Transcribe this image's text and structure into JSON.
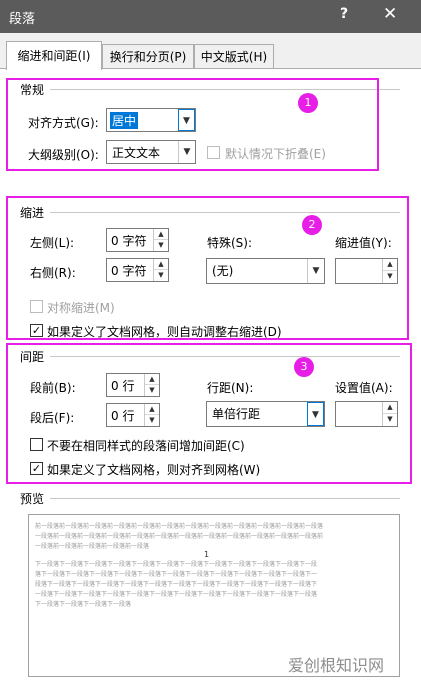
{
  "window": {
    "title": "段落",
    "help_glyph": "?",
    "close_glyph": "✕"
  },
  "tabs": [
    {
      "label": "缩进和间距(I)",
      "active": true
    },
    {
      "label": "换行和分页(P)",
      "active": false
    },
    {
      "label": "中文版式(H)",
      "active": false
    }
  ],
  "general": {
    "title": "常规",
    "alignment_label": "对齐方式(G):",
    "alignment_value": "居中",
    "outline_label": "大纲级别(O):",
    "outline_value": "正文文本",
    "collapse_label": "默认情况下折叠(E)",
    "collapse_checked": false
  },
  "indent": {
    "title": "缩进",
    "left_label": "左侧(L):",
    "left_value": "0 字符",
    "right_label": "右侧(R):",
    "right_value": "0 字符",
    "special_label": "特殊(S):",
    "special_value": "(无)",
    "by_label": "缩进值(Y):",
    "by_value": "",
    "mirror_label": "对称缩进(M)",
    "mirror_checked": false,
    "auto_adjust_label": "如果定义了文档网格，则自动调整右缩进(D)",
    "auto_adjust_checked": true
  },
  "spacing": {
    "title": "间距",
    "before_label": "段前(B):",
    "before_value": "0 行",
    "after_label": "段后(F):",
    "after_value": "0 行",
    "line_label": "行距(N):",
    "line_value": "单倍行距",
    "at_label": "设置值(A):",
    "at_value": "",
    "no_space_label": "不要在相同样式的段落间增加间距(C)",
    "no_space_checked": false,
    "snap_grid_label": "如果定义了文档网格，则对齐到网格(W)",
    "snap_grid_checked": true
  },
  "preview": {
    "title": "预览",
    "lines": [
      "前一段落前一段落前一段落前一段落前一段落前一段落前一段落前一段落前一段落前一段落前一段落前一段落",
      "一段落前一段落前一段落前一段落前一段落前一段落前一段落前一段落前一段落前一段落前一段落前一段落前",
      "一段落前一段落前一段落前一段落前一段落",
      "下一段落下一段落下一段落下一段落下一段落下一段落下一段落下一段落下一段落下一段落下一段落下一段",
      "落下一段落下一段落下一段落下一段落下一段落下一段落下一段落下一段落下一段落下一段落下一段落下一",
      "段落下一段落下一段落下一段落下一段落下一段落下一段落下一段落下一段落下一段落下一段落下一段落下",
      "一段落下一段落下一段落下一段落下一段落下一段落下一段落下一段落下一段落下一段落下一段落下一段落",
      "下一段落下一段落下一段落下一段落"
    ],
    "cursor": "1"
  },
  "annotations": {
    "badge_1": "1",
    "badge_2": "2",
    "badge_3": "3",
    "color": "#e61ee6"
  },
  "watermark": "爱创根知识网"
}
